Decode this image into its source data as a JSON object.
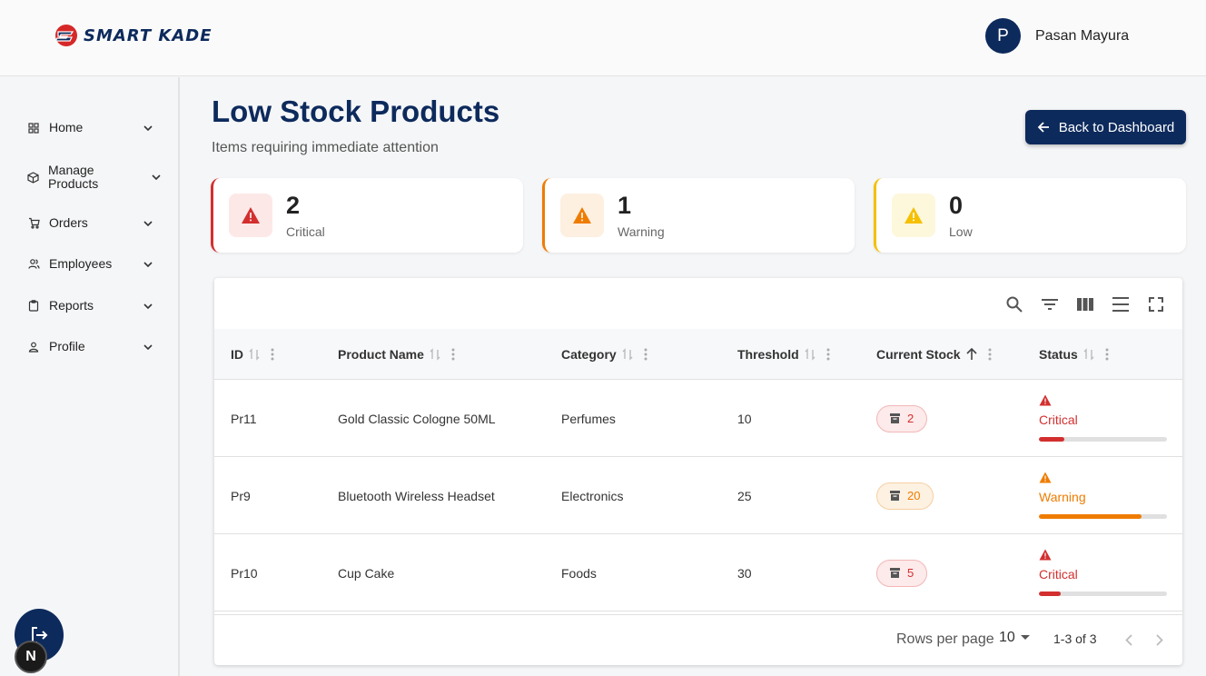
{
  "header": {
    "logo_text": "SMART KADE",
    "user": {
      "initial": "P",
      "name": "Pasan Mayura"
    }
  },
  "sidebar": {
    "items": [
      {
        "label": "Home",
        "icon": "grid-icon"
      },
      {
        "label": "Manage Products",
        "icon": "box-icon"
      },
      {
        "label": "Orders",
        "icon": "cart-icon"
      },
      {
        "label": "Employees",
        "icon": "users-icon"
      },
      {
        "label": "Reports",
        "icon": "clipboard-icon"
      },
      {
        "label": "Profile",
        "icon": "user-icon"
      }
    ],
    "fab_n": "N"
  },
  "page": {
    "title": "Low Stock Products",
    "subtitle": "Items requiring immediate attention",
    "back_button": "Back to Dashboard"
  },
  "stats": [
    {
      "value": "2",
      "label": "Critical",
      "color": "#d32f2f",
      "bg": "#fde8e8"
    },
    {
      "value": "1",
      "label": "Warning",
      "color": "#ef7c00",
      "bg": "#fdf0e1"
    },
    {
      "value": "0",
      "label": "Low",
      "color": "#f5c000",
      "bg": "#fdf7dc"
    }
  ],
  "table": {
    "columns": [
      "ID",
      "Product Name",
      "Category",
      "Threshold",
      "Current Stock",
      "Status"
    ],
    "sorted_column": "Current Stock",
    "sort_direction": "ascending",
    "rows": [
      {
        "id": "Pr11",
        "name": "Gold Classic Cologne 50ML",
        "category": "Perfumes",
        "threshold": "10",
        "stock": "2",
        "status": "Critical",
        "level": 0.2
      },
      {
        "id": "Pr9",
        "name": "Bluetooth Wireless Headset",
        "category": "Electronics",
        "threshold": "25",
        "stock": "20",
        "status": "Warning",
        "level": 0.8
      },
      {
        "id": "Pr10",
        "name": "Cup Cake",
        "category": "Foods",
        "threshold": "30",
        "stock": "5",
        "status": "Critical",
        "level": 0.17
      }
    ],
    "footer": {
      "rows_per_page_label": "Rows per page",
      "rows_per_page": "10",
      "range": "1-3 of 3"
    }
  },
  "colors": {
    "primary": "#0d2a5c",
    "critical": "#d32f2f",
    "warning": "#ef7c00",
    "low": "#f5c000"
  }
}
